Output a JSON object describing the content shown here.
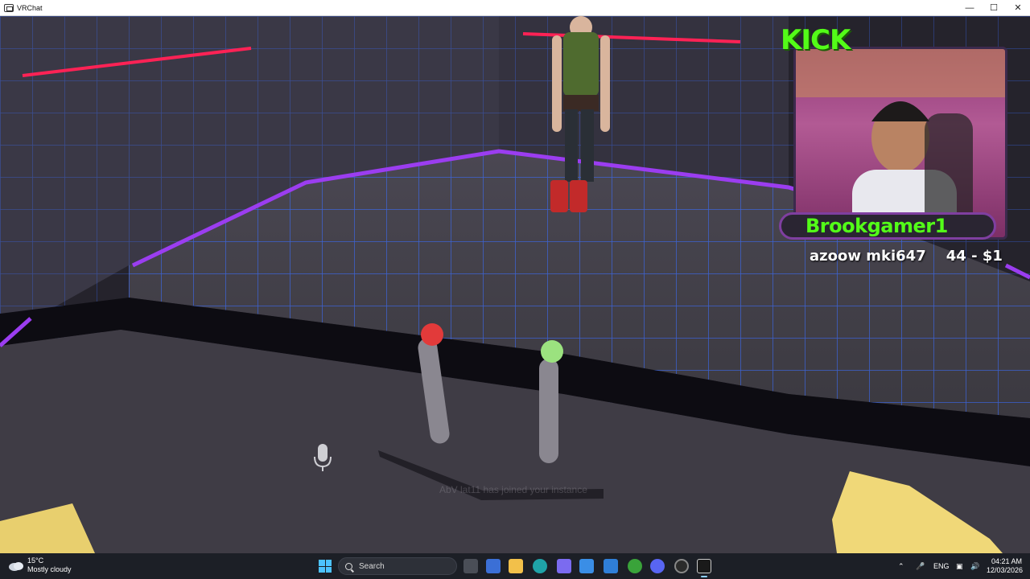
{
  "window": {
    "title": "VRChat",
    "controls": [
      "minimize-icon",
      "maximize-icon",
      "close-icon"
    ]
  },
  "overlay": {
    "platform_logo": "KICK",
    "streamer_name": "Brookgamer1",
    "donation_text": "azoow mki647    44 - $1",
    "colors": {
      "kick_green": "#53fc18",
      "frame_purple": "#7f3fa0"
    }
  },
  "game": {
    "join_notification": "AbV lat11 has joined your instance",
    "mic_icon": "microphone-icon",
    "colors": {
      "neon_purple": "#9b3df0",
      "neon_red": "#ff2255",
      "grid_blue": "#3b6dff"
    }
  },
  "taskbar": {
    "weather": {
      "temp": "15°C",
      "condition": "Mostly cloudy"
    },
    "search_placeholder": "Search",
    "language": "ENG",
    "time": "04:21 AM",
    "date": "12/03/2026"
  }
}
